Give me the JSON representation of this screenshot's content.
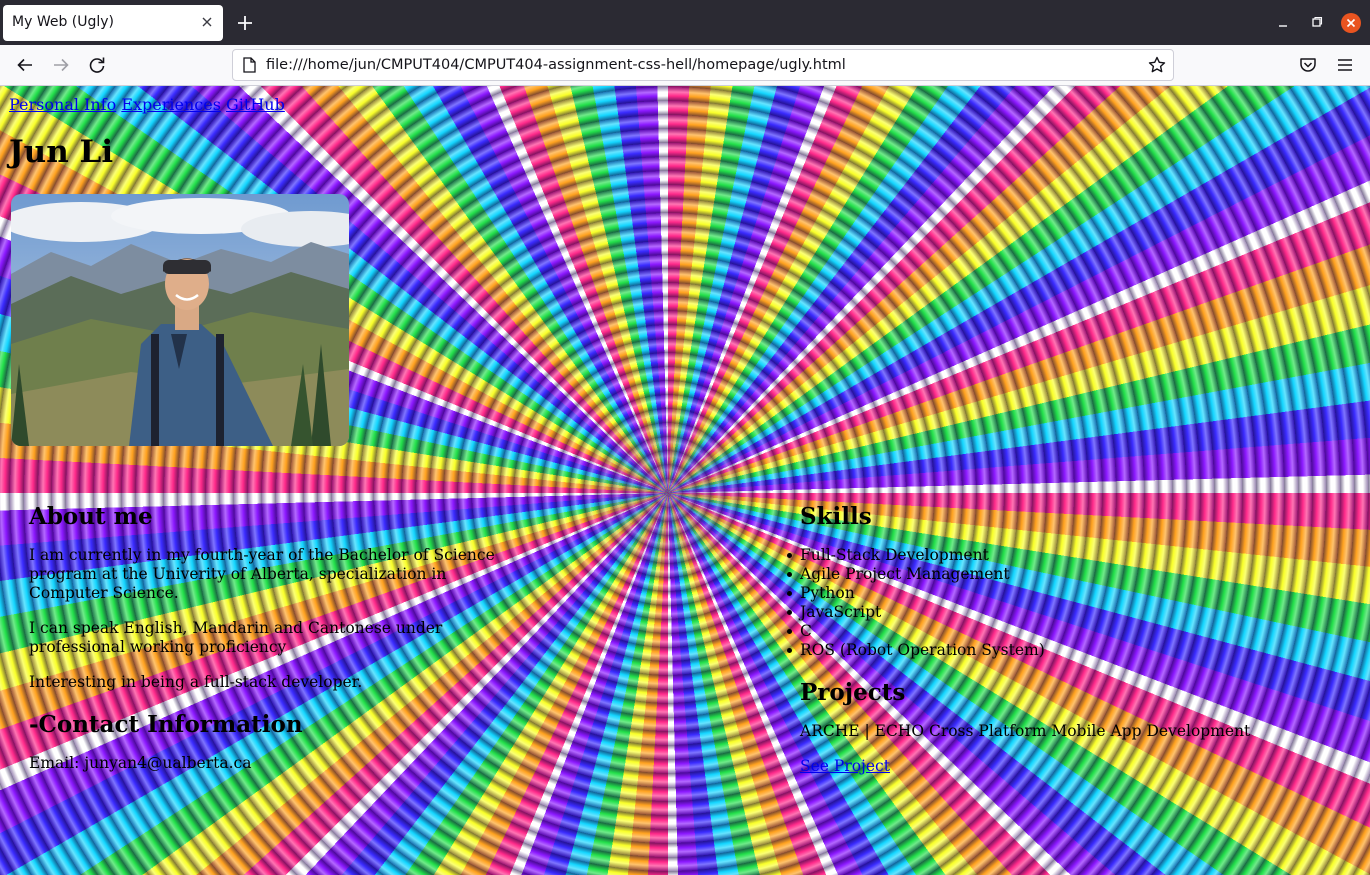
{
  "browser": {
    "tab_title": "My Web (Ugly)",
    "url": "file:///home/jun/CMPUT404/CMPUT404-assignment-css-hell/homepage/ugly.html"
  },
  "page": {
    "nav_links": [
      "Personal Info",
      "Experiences",
      "GitHub"
    ],
    "name": "Jun Li",
    "about": {
      "heading": "About me",
      "paragraphs": [
        "I am currently in my fourth-year of the Bachelor of Science program at the Univerity of Alberta, specialization in Computer Science.",
        "I can speak English, Mandarin and Cantonese under professional working proficiency",
        "Interesting in being a full-stack developer."
      ]
    },
    "contact": {
      "heading": "-Contact Information",
      "email_line": "Email: junyan4@ualberta.ca"
    },
    "skills": {
      "heading": "Skills",
      "items": [
        "Full-Stack Development",
        "Agile Project Management",
        "Python",
        "JavaScript",
        "C",
        "ROS (Robot Operation System)"
      ]
    },
    "projects": {
      "heading": "Projects",
      "title": "ARCHE | ECHO Cross Platform Mobile App Development",
      "link": "See Project"
    }
  },
  "colors": {
    "link": "#0000ee",
    "toolbar": "#f9f9fb",
    "tabstrip": "#2b2a33",
    "close_button": "#e95420"
  }
}
